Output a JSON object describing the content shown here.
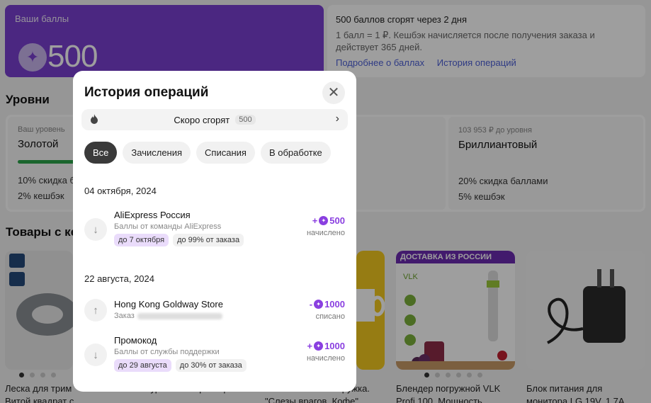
{
  "points": {
    "label": "Ваши баллы",
    "value": "500",
    "coin_icon": "star-coin-icon"
  },
  "info": {
    "expire_text": "500 баллов сгорят через 2 дня",
    "desc": "1 балл = 1 ₽. Кешбэк начисляется после получения заказа и действует 365 дней.",
    "link_more": "Подробнее о баллах",
    "link_history": "История операций"
  },
  "levels": {
    "title": "Уровни",
    "current": {
      "caption": "Ваш уровень",
      "name": "Золотой",
      "line1": "10% скидка б",
      "line2": "2% кешбэк"
    },
    "next": {
      "caption": "103 953 ₽ до уровня",
      "name": "Бриллиантовый",
      "line1": "20% скидка баллами",
      "line2": "5% кешбэк"
    }
  },
  "goods": {
    "title": "Товары с ке",
    "items": [
      {
        "title": "Леска для трим",
        "title2": "Витой квадрат с"
      },
      {
        "title": "",
        "title2": "Натуральный Границы"
      },
      {
        "title": "ружка.",
        "title2": "\"Слезы врагов. Кофе\""
      },
      {
        "title": "Блендер погружной VLK",
        "title2": "Profi 100. Мощность"
      },
      {
        "title": "Блок питания для",
        "title2": "монитора LG 19V, 1.7А"
      }
    ],
    "banner_text": "ДОСТАВКА ИЗ РОССИИ"
  },
  "modal": {
    "title": "История операций",
    "soon_label": "Скоро сгорят",
    "soon_count": "500",
    "tabs": [
      "Все",
      "Зачисления",
      "Списания",
      "В обработке"
    ],
    "groups": [
      {
        "date": "04 октября, 2024",
        "ops": [
          {
            "name": "AliExpress Россия",
            "sub": "Баллы от команды AliExpress",
            "chips": [
              "до 7 октября",
              "до 99% от заказа"
            ],
            "amount": "+500",
            "status": "начислено",
            "dir": "in"
          }
        ]
      },
      {
        "date": "22 августа, 2024",
        "ops": [
          {
            "name": "Hong Kong Goldway Store",
            "sub": "Заказ",
            "chips": [],
            "amount": "-1000",
            "status": "списано",
            "dir": "out"
          },
          {
            "name": "Промокод",
            "sub": "Баллы от службы поддержки",
            "chips": [
              "до 29 августа",
              "до 30% от заказа"
            ],
            "amount": "+1000",
            "status": "начислено",
            "dir": "in"
          }
        ]
      }
    ]
  }
}
